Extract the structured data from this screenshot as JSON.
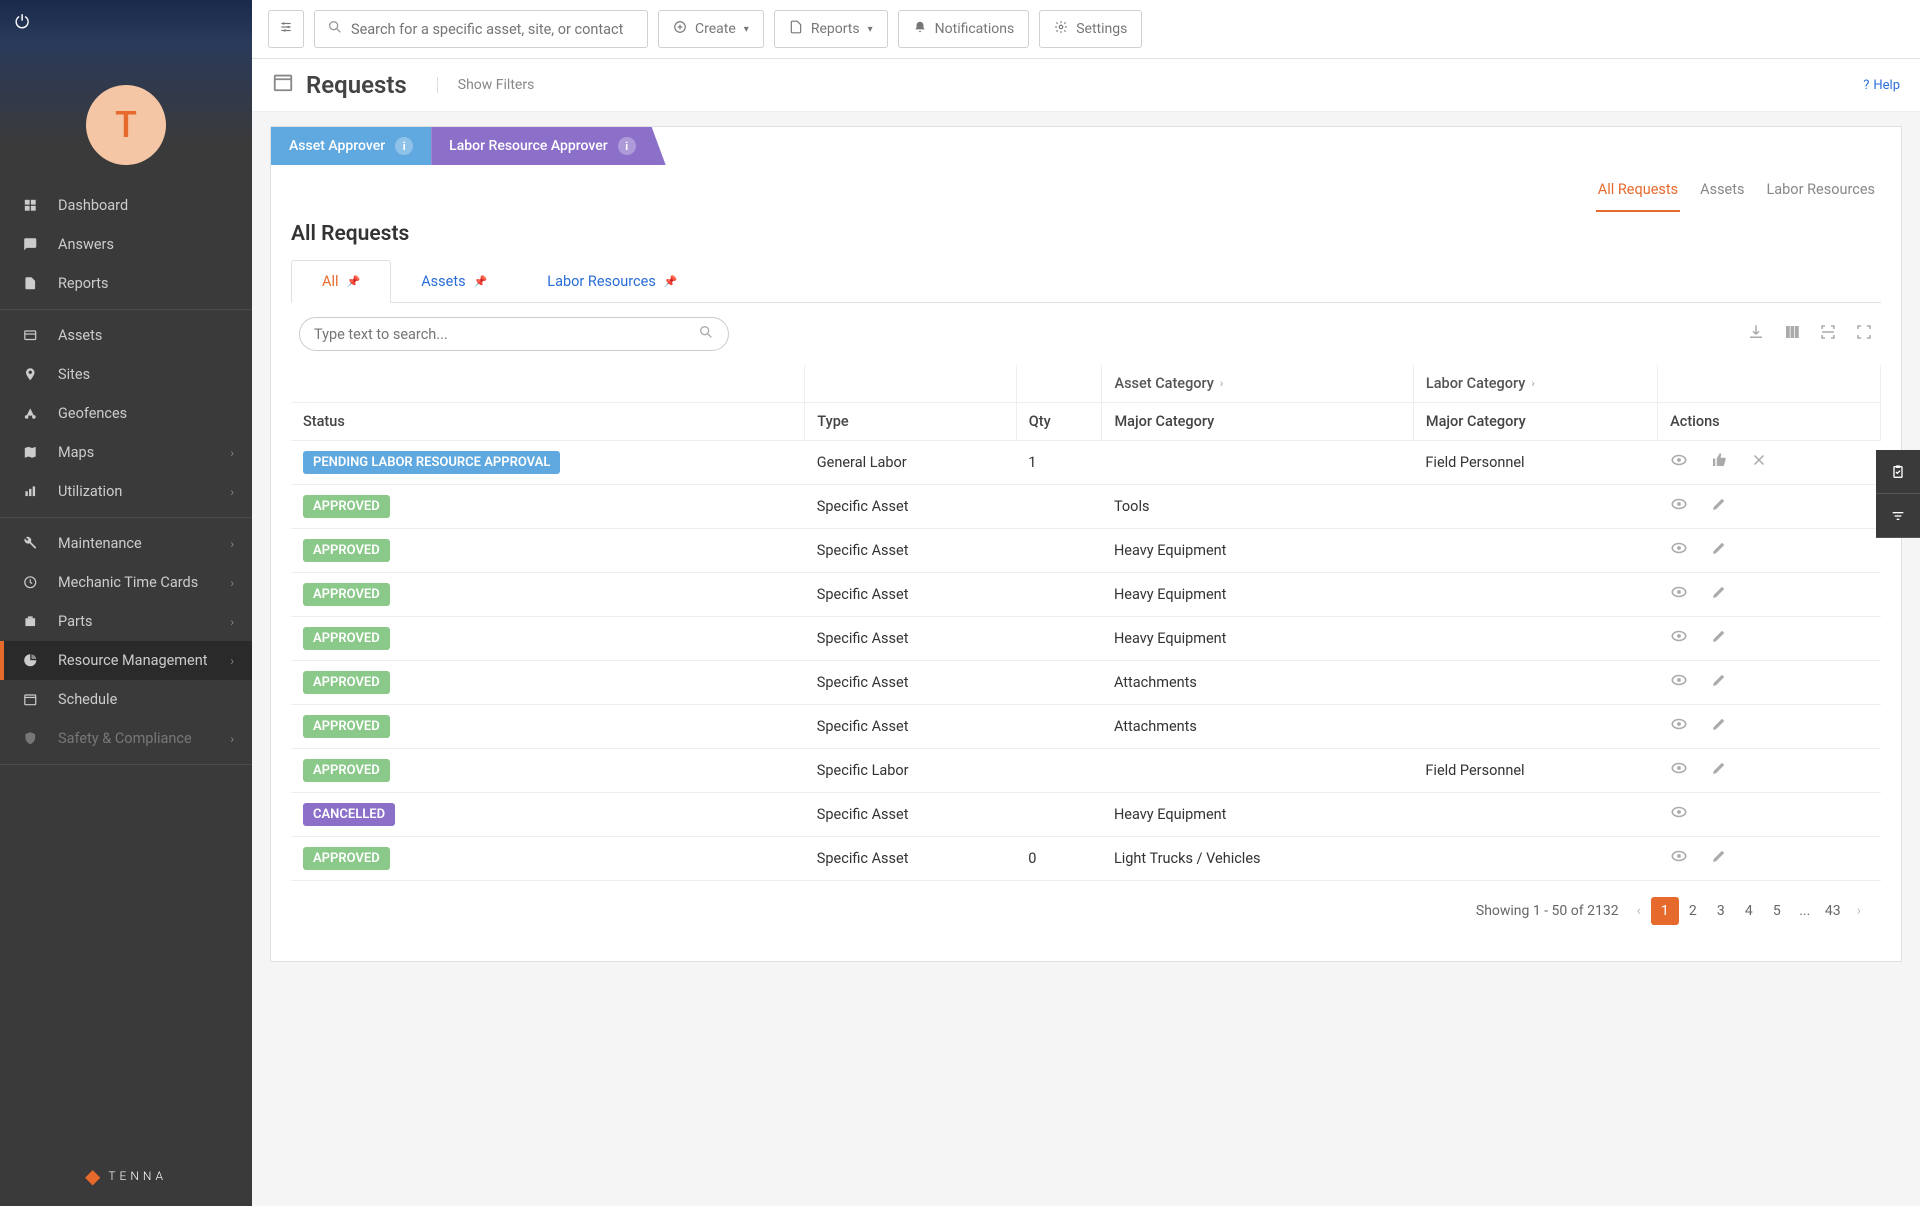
{
  "avatar_letter": "T",
  "sidebar": {
    "items": [
      {
        "label": "Dashboard"
      },
      {
        "label": "Answers"
      },
      {
        "label": "Reports"
      },
      {
        "label": "Assets"
      },
      {
        "label": "Sites"
      },
      {
        "label": "Geofences"
      },
      {
        "label": "Maps"
      },
      {
        "label": "Utilization"
      },
      {
        "label": "Maintenance"
      },
      {
        "label": "Mechanic Time Cards"
      },
      {
        "label": "Parts"
      },
      {
        "label": "Resource Management"
      },
      {
        "label": "Schedule"
      },
      {
        "label": "Safety & Compliance"
      }
    ],
    "brand": "TENNA"
  },
  "topbar": {
    "search_placeholder": "Search for a specific asset, site, or contact",
    "create": "Create",
    "reports": "Reports",
    "notifications": "Notifications",
    "settings": "Settings"
  },
  "page": {
    "title": "Requests",
    "show_filters": "Show Filters",
    "help": "Help"
  },
  "approver_tabs": {
    "asset": "Asset Approver",
    "labor": "Labor Resource Approver"
  },
  "scope_tabs": {
    "all": "All Requests",
    "assets": "Assets",
    "labor": "Labor Resources"
  },
  "section_title": "All Requests",
  "view_tabs": {
    "all": "All",
    "assets": "Assets",
    "labor": "Labor Resources"
  },
  "table_search_placeholder": "Type text to search...",
  "columns": {
    "status": "Status",
    "type": "Type",
    "qty": "Qty",
    "asset_cat_group": "Asset Category",
    "labor_cat_group": "Labor Category",
    "major_cat": "Major Category",
    "actions": "Actions"
  },
  "status_labels": {
    "pending": "PENDING LABOR RESOURCE APPROVAL",
    "approved": "APPROVED",
    "cancelled": "CANCELLED"
  },
  "rows": [
    {
      "status": "pending",
      "type": "General Labor",
      "qty": "1",
      "asset_cat": "",
      "labor_cat": "Field Personnel",
      "actions": [
        "view",
        "thumb",
        "close"
      ]
    },
    {
      "status": "approved",
      "type": "Specific Asset",
      "qty": "",
      "asset_cat": "Tools",
      "labor_cat": "",
      "actions": [
        "view",
        "edit"
      ]
    },
    {
      "status": "approved",
      "type": "Specific Asset",
      "qty": "",
      "asset_cat": "Heavy Equipment",
      "labor_cat": "",
      "actions": [
        "view",
        "edit"
      ]
    },
    {
      "status": "approved",
      "type": "Specific Asset",
      "qty": "",
      "asset_cat": "Heavy Equipment",
      "labor_cat": "",
      "actions": [
        "view",
        "edit"
      ]
    },
    {
      "status": "approved",
      "type": "Specific Asset",
      "qty": "",
      "asset_cat": "Heavy Equipment",
      "labor_cat": "",
      "actions": [
        "view",
        "edit"
      ]
    },
    {
      "status": "approved",
      "type": "Specific Asset",
      "qty": "",
      "asset_cat": "Attachments",
      "labor_cat": "",
      "actions": [
        "view",
        "edit"
      ]
    },
    {
      "status": "approved",
      "type": "Specific Asset",
      "qty": "",
      "asset_cat": "Attachments",
      "labor_cat": "",
      "actions": [
        "view",
        "edit"
      ]
    },
    {
      "status": "approved",
      "type": "Specific Labor",
      "qty": "",
      "asset_cat": "",
      "labor_cat": "Field Personnel",
      "actions": [
        "view",
        "edit"
      ]
    },
    {
      "status": "cancelled",
      "type": "Specific Asset",
      "qty": "",
      "asset_cat": "Heavy Equipment",
      "labor_cat": "",
      "actions": [
        "view"
      ]
    },
    {
      "status": "approved",
      "type": "Specific Asset",
      "qty": "0",
      "asset_cat": "Light Trucks / Vehicles",
      "labor_cat": "",
      "actions": [
        "view",
        "edit"
      ]
    }
  ],
  "pagination": {
    "info": "Showing 1 - 50 of 2132",
    "pages": [
      "1",
      "2",
      "3",
      "4",
      "5",
      "...",
      "43"
    ]
  }
}
